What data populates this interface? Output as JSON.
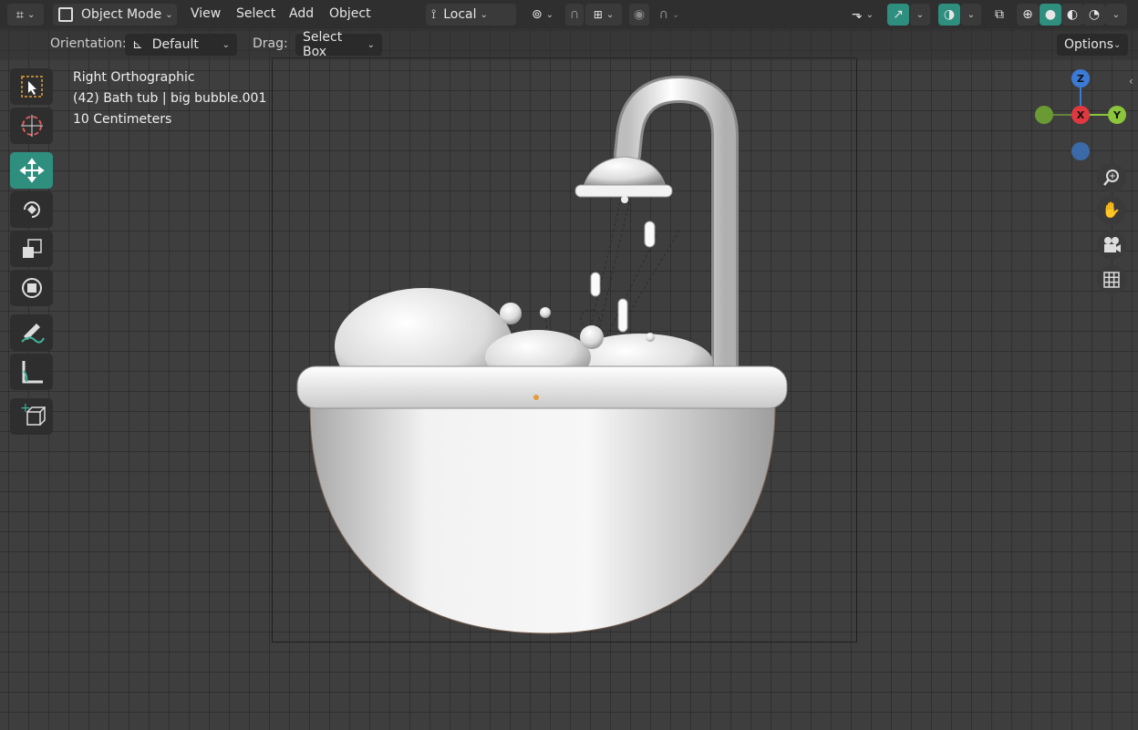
{
  "header": {
    "mode_label": "Object Mode",
    "menus": [
      "View",
      "Select",
      "Add",
      "Object"
    ],
    "transform_pivot": "Local",
    "options_label": "Options"
  },
  "toolsettings": {
    "orientation_label": "Orientation:",
    "orientation_value": "Default",
    "drag_label": "Drag:",
    "drag_value": "Select Box"
  },
  "overlay": {
    "view_name": "Right Orthographic",
    "object_info": "(42) Bath tub | big bubble.001",
    "scale": "10 Centimeters"
  },
  "gizmo": {
    "z": "Z",
    "x": "X",
    "y": "Y"
  },
  "colors": {
    "accent": "#2f8f7e",
    "axis_z": "#3b7ad6",
    "axis_x": "#e0383f",
    "axis_y": "#8ac53b"
  },
  "icons": [
    "editor-type-icon",
    "object-mode-icon",
    "transform-orientation-icon",
    "snap-icon",
    "proportional-edit-icon",
    "select-tool-icon",
    "cursor-tool-icon",
    "move-tool-icon",
    "rotate-tool-icon",
    "scale-tool-icon",
    "transform-tool-icon",
    "annotate-tool-icon",
    "measure-tool-icon",
    "add-cube-icon",
    "zoom-icon",
    "hand-icon",
    "camera-icon",
    "grid-icon"
  ]
}
